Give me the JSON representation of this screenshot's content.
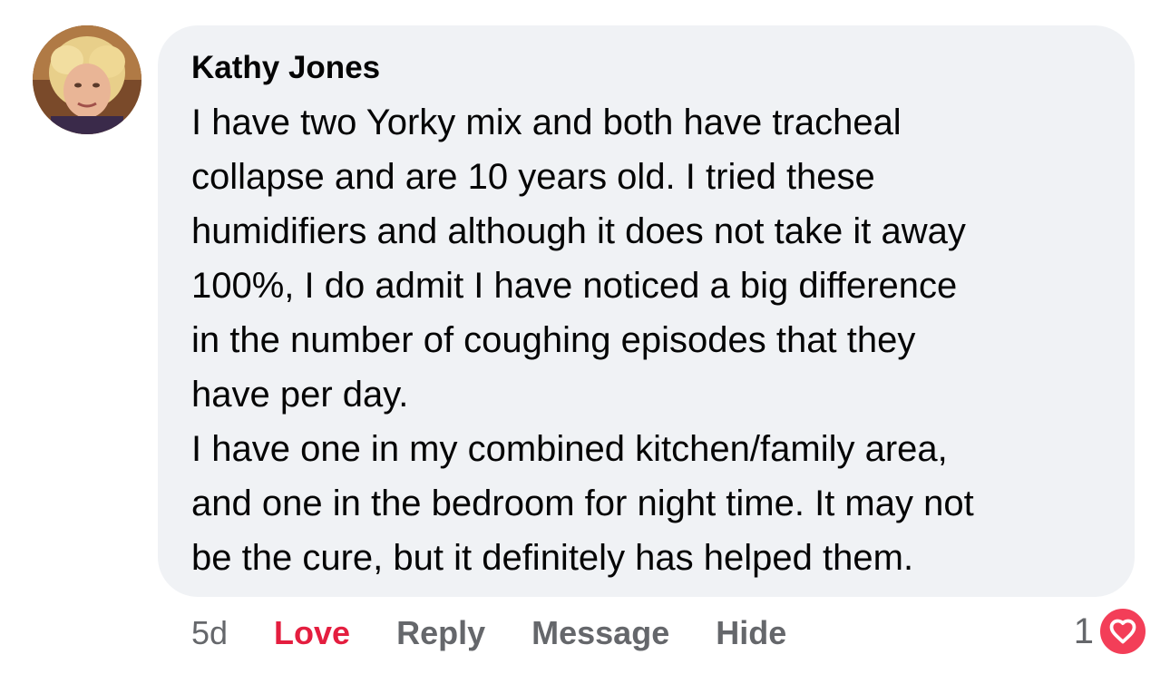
{
  "comment": {
    "author": "Kathy Jones",
    "lines": [
      "I have two Yorky mix and both have tracheal",
      "collapse and are 10 years old. I tried these",
      "humidifiers and although it does not take it away",
      "100%, I do admit I have noticed a big difference",
      "in the number of coughing episodes that they",
      "have per day.",
      "I have one in my combined kitchen/family area,",
      "and one in the bedroom for night time. It may not",
      "be the cure, but it definitely has helped them."
    ]
  },
  "actions": {
    "timestamp": "5d",
    "love_label": "Love",
    "reply_label": "Reply",
    "message_label": "Message",
    "hide_label": "Hide"
  },
  "reactions": {
    "count": "1",
    "icon": "heart-icon"
  },
  "colors": {
    "bubble_bg": "#f0f2f5",
    "love_red": "#e41e3f",
    "secondary_text": "#65676b",
    "heart_badge": "#f33e58"
  }
}
